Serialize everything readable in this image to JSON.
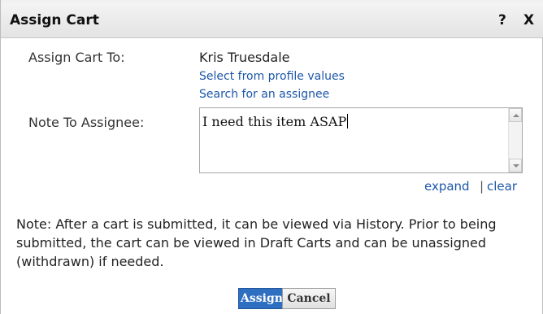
{
  "dialog": {
    "title": "Assign Cart",
    "help_label": "?",
    "close_label": "X"
  },
  "assign_to": {
    "label": "Assign Cart To:",
    "value": "Kris Truesdale",
    "select_link": "Select from profile values",
    "search_link": "Search for an assignee"
  },
  "note_field": {
    "label": "Note To Assignee:",
    "value": "I need this item ASAP",
    "expand_link": "expand",
    "separator": "|",
    "clear_link": "clear"
  },
  "info_note": "Note: After a cart is submitted, it can be viewed via History. Prior to being submitted, the cart can be viewed in Draft Carts and can be unassigned (withdrawn) if needed.",
  "buttons": {
    "assign": "Assign",
    "cancel": "Cancel"
  },
  "colors": {
    "primary_button": "#2f6fc1",
    "link": "#1c57a8"
  }
}
